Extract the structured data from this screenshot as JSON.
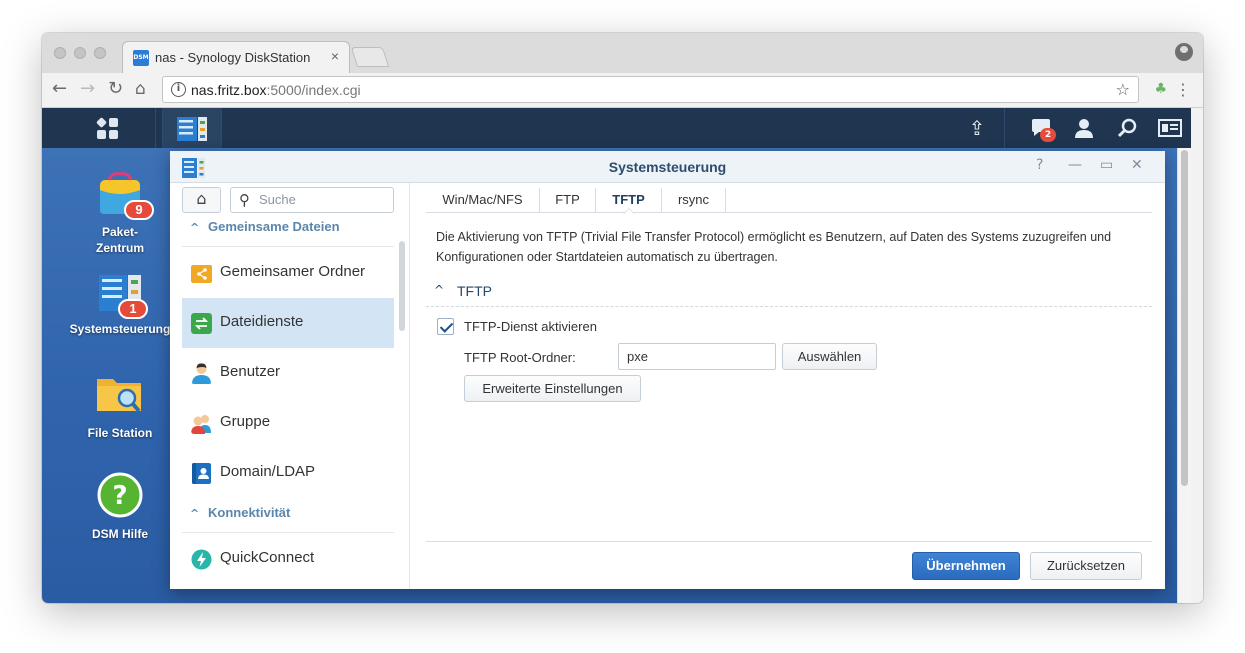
{
  "browser": {
    "tab_title": "nas - Synology DiskStation",
    "favicon_text": "DSM",
    "tab_close": "×",
    "url_host": "nas.fritz.box",
    "url_rest": ":5000/index.cgi"
  },
  "taskbar": {
    "notification_count": "2"
  },
  "desktop": {
    "icons": [
      {
        "label": "Paket-\nZentrum",
        "badge": "9"
      },
      {
        "label": "Systemsteuerung",
        "badge": "1"
      },
      {
        "label": "File Station"
      },
      {
        "label": "DSM Hilfe"
      }
    ]
  },
  "window": {
    "title": "Systemsteuerung",
    "help": "?",
    "minimize": "—",
    "maximize": "▭",
    "close": "✕"
  },
  "sidebar": {
    "search_placeholder": "Suche",
    "sections": [
      {
        "title": "Gemeinsame Dateien",
        "items": [
          "Gemeinsamer Ordner",
          "Dateidienste",
          "Benutzer",
          "Gruppe",
          "Domain/LDAP"
        ]
      },
      {
        "title": "Konnektivität",
        "items": [
          "QuickConnect"
        ]
      }
    ],
    "active_item": "Dateidienste"
  },
  "tabs": [
    "Win/Mac/NFS",
    "FTP",
    "TFTP",
    "rsync"
  ],
  "active_tab": "TFTP",
  "content": {
    "description": "Die Aktivierung von TFTP (Trivial File Transfer Protocol) ermöglicht es Benutzern, auf Daten des Systems zuzugreifen und Konfigurationen oder Startdateien automatisch zu übertragen.",
    "section_title": "TFTP",
    "enable_label": "TFTP-Dienst aktivieren",
    "enable_checked": true,
    "root_label": "TFTP Root-Ordner:",
    "root_value": "pxe",
    "select_button": "Auswählen",
    "advanced_button": "Erweiterte Einstellungen"
  },
  "footer": {
    "apply_button": "Übernehmen",
    "reset_button": "Zurücksetzen"
  },
  "colors": {
    "accent": "#2a6bbd",
    "sidebar_active": "#d3e4f5",
    "section_heading": "#5b86ac",
    "badge": "#e64a3b"
  }
}
